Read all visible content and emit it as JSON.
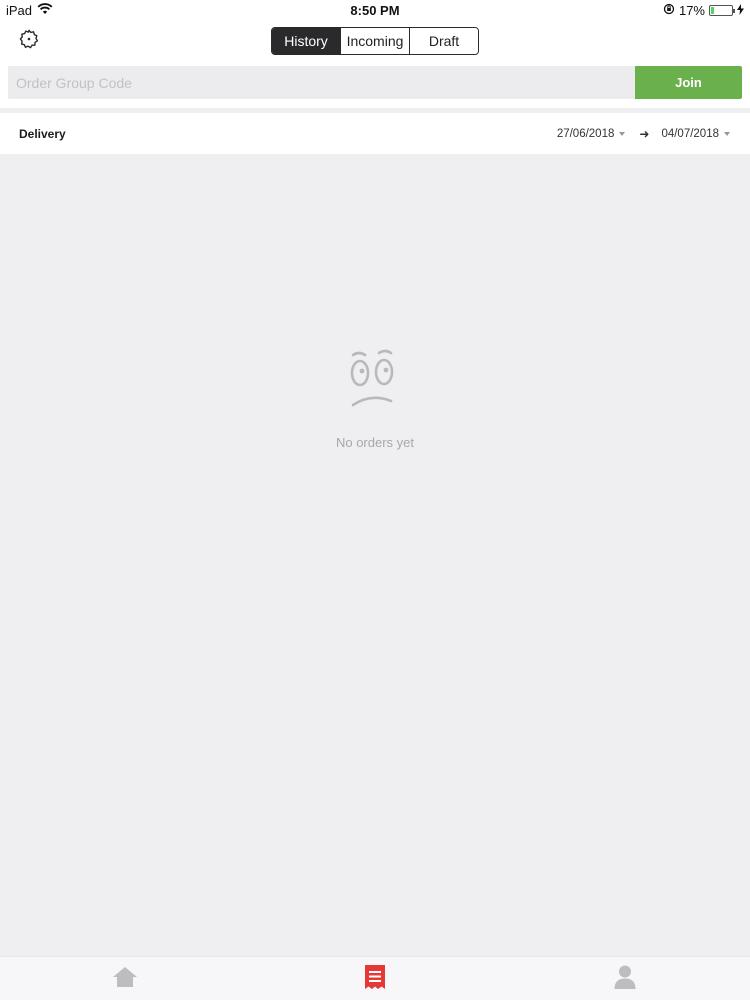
{
  "status_bar": {
    "device": "iPad",
    "time": "8:50 PM",
    "battery_percent_label": "17%",
    "battery_level": 0.17
  },
  "header": {
    "segments": [
      "History",
      "Incoming",
      "Draft"
    ],
    "active_segment": "History",
    "settings_icon": "gear-icon"
  },
  "join": {
    "placeholder": "Order Group Code",
    "value": "",
    "button_label": "Join",
    "button_color": "#6ab04c"
  },
  "delivery": {
    "label": "Delivery",
    "date_from": "27/06/2018",
    "date_to": "04/07/2018"
  },
  "empty_state": {
    "icon": "sad-face-icon",
    "message": "No orders yet"
  },
  "tab_bar": {
    "items": [
      {
        "icon": "home-icon",
        "active": false
      },
      {
        "icon": "orders-icon",
        "active": true
      },
      {
        "icon": "profile-icon",
        "active": false
      }
    ],
    "active_color": "#e53935",
    "inactive_color": "#bdbdc0"
  }
}
